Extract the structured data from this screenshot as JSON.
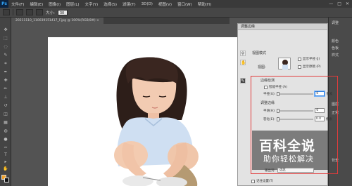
{
  "app": {
    "logo": "Ps"
  },
  "menubar": {
    "items": [
      "文件(F)",
      "编辑(E)",
      "图像(I)",
      "图层(L)",
      "文字(Y)",
      "选择(S)",
      "滤镜(T)",
      "3D(D)",
      "视图(V)",
      "窗口(W)",
      "帮助(H)"
    ],
    "window_controls": [
      "—",
      "□",
      "✕"
    ]
  },
  "options_bar": {
    "size_label": "大小:",
    "size_value": "30"
  },
  "document_tab": {
    "title": "20211110_110039151417_F.jpg @ 100%(RGB/8#) ×"
  },
  "right_panel": {
    "labels": [
      "调整",
      "",
      "颜色",
      "色板",
      "样式",
      "",
      "图层",
      "正常",
      "背景"
    ]
  },
  "dialog": {
    "title": "调整边缘",
    "view_mode_section": "视图模式",
    "view_label": "视图:",
    "show_radius": "显示半径 (J)",
    "show_original": "显示原稿 (P)",
    "edge_detection_section": "边缘检测",
    "smart_radius": "智能半径 (A)",
    "radius_label": "半径(U):",
    "radius_value": "0",
    "radius_unit": "像素",
    "adjust_edge_section": "调整边缘",
    "smooth_label": "平滑(H):",
    "smooth_value": "0",
    "feather_label": "羽化(E):",
    "feather_value": "0.0",
    "feather_unit": "像素",
    "output_to_label": "输出到:",
    "output_to_value": "选区",
    "remember_settings": "记住设置(T)"
  },
  "watermark": {
    "title": "百科全说",
    "subtitle": "助你轻松解决"
  },
  "colors": {
    "foreground": "#f1a129",
    "background": "#111111",
    "highlight": "#e23c3c"
  }
}
